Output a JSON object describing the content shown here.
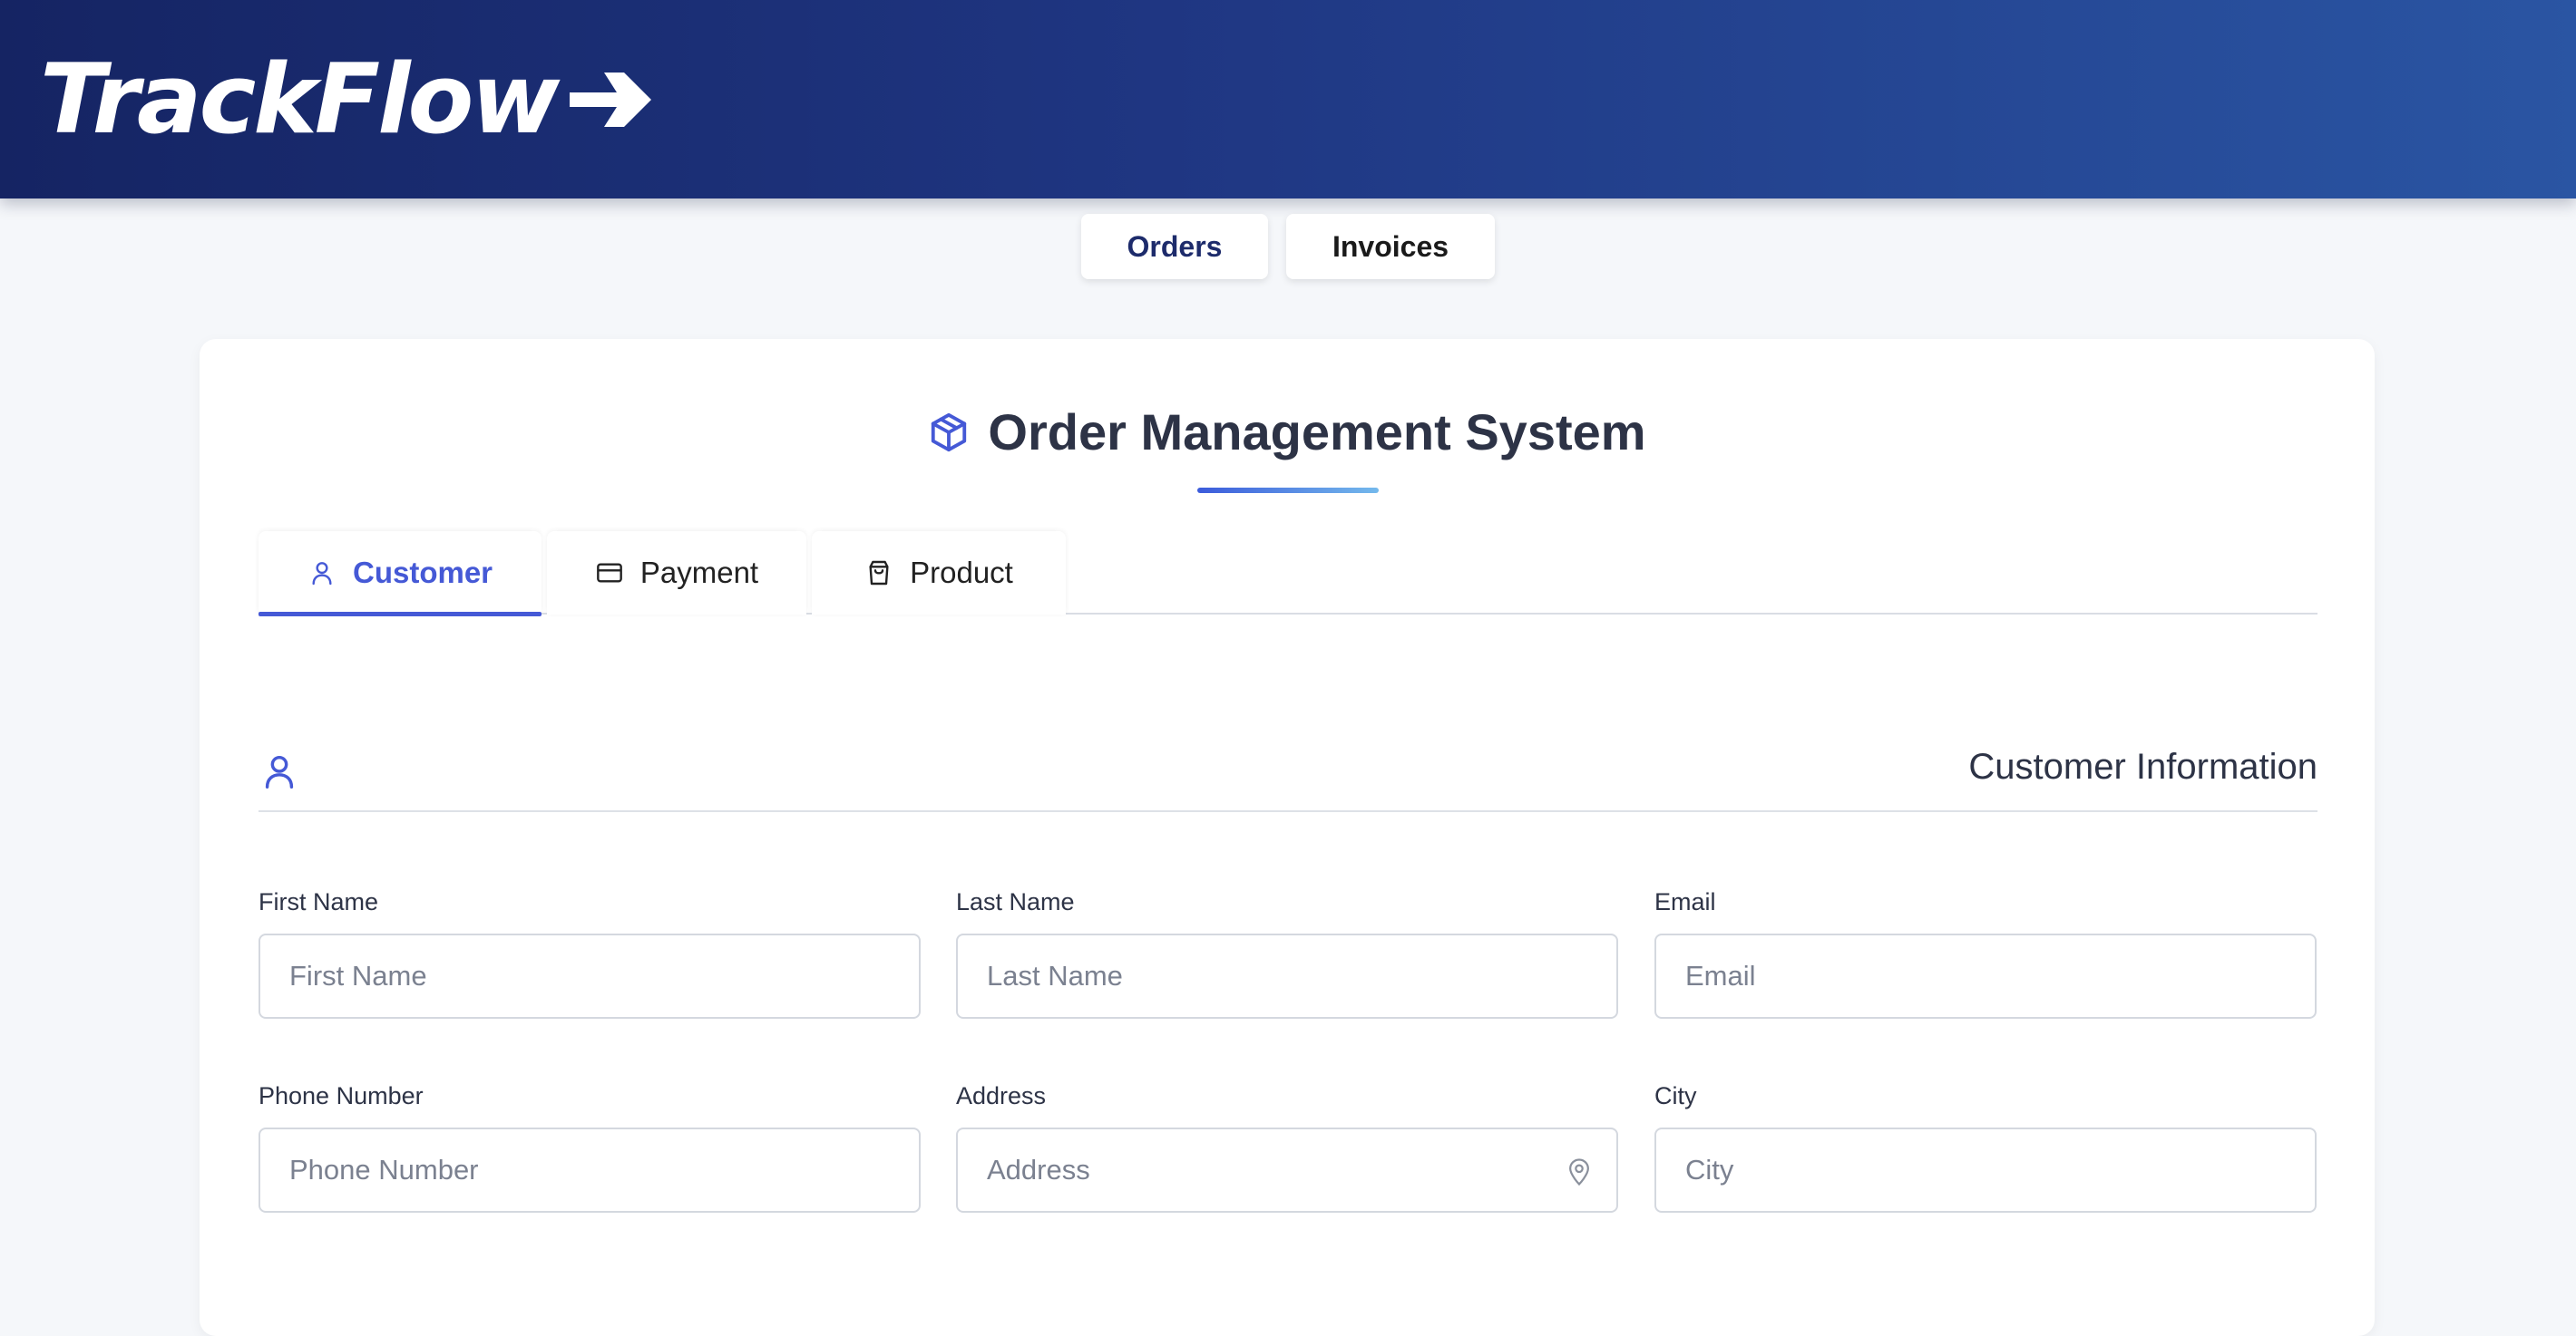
{
  "header": {
    "logo_text": "TrackFlow",
    "logo_icon": "arrow-right-icon"
  },
  "nav": {
    "items": [
      {
        "label": "Orders",
        "active": true
      },
      {
        "label": "Invoices",
        "active": false
      }
    ]
  },
  "main": {
    "title": "Order Management System",
    "title_icon": "package-icon",
    "tabs": [
      {
        "label": "Customer",
        "icon": "user-icon",
        "active": true
      },
      {
        "label": "Payment",
        "icon": "credit-card-icon",
        "active": false
      },
      {
        "label": "Product",
        "icon": "shopping-bag-icon",
        "active": false
      }
    ],
    "section": {
      "title": "Customer Information",
      "icon": "user-icon"
    },
    "fields": [
      {
        "label": "First Name",
        "placeholder": "First Name",
        "value": ""
      },
      {
        "label": "Last Name",
        "placeholder": "Last Name",
        "value": ""
      },
      {
        "label": "Email",
        "placeholder": "Email",
        "value": ""
      },
      {
        "label": "Phone Number",
        "placeholder": "Phone Number",
        "value": ""
      },
      {
        "label": "Address",
        "placeholder": "Address",
        "value": "",
        "icon": "map-pin-icon"
      },
      {
        "label": "City",
        "placeholder": "City",
        "value": ""
      }
    ]
  },
  "colors": {
    "header_start": "#152463",
    "header_end": "#2a55a3",
    "accent": "#4559d6",
    "page_bg": "#f5f7fa"
  }
}
